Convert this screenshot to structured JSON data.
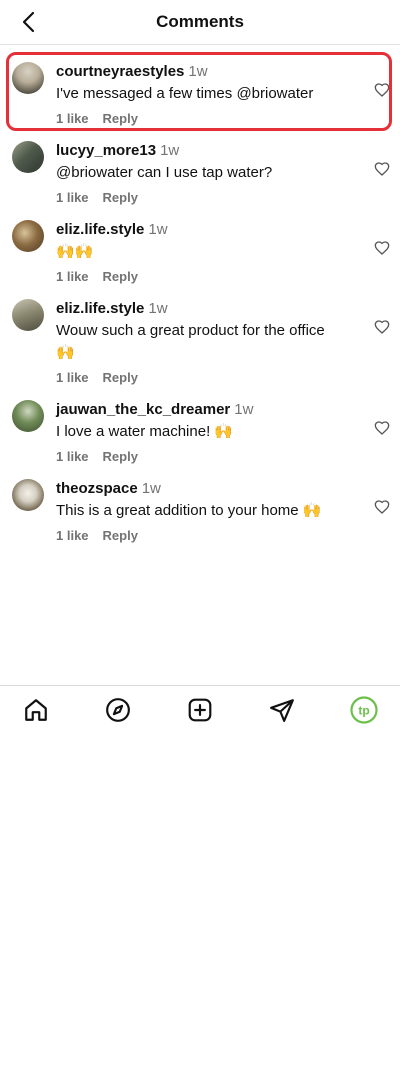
{
  "header": {
    "title": "Comments"
  },
  "comments": [
    {
      "username": "courtneyraestyles",
      "time": "1w",
      "text": "I've messaged a few times @briowater",
      "likes": "1 like",
      "reply": "Reply"
    },
    {
      "username": "lucyy_more13",
      "time": "1w",
      "text": "@briowater can I use tap water?",
      "likes": "1 like",
      "reply": "Reply"
    },
    {
      "username": "eliz.life.style",
      "time": "1w",
      "text": "🙌🙌",
      "likes": "1 like",
      "reply": "Reply"
    },
    {
      "username": "eliz.life.style",
      "time": "1w",
      "text": "Wouw such a great product for the office 🙌",
      "likes": "1 like",
      "reply": "Reply"
    },
    {
      "username": "jauwan_the_kc_dreamer",
      "time": "1w",
      "text": "I love a water machine! 🙌",
      "likes": "1 like",
      "reply": "Reply"
    },
    {
      "username": "theozspace",
      "time": "1w",
      "text": "This is a great addition to your home 🙌",
      "likes": "1 like",
      "reply": "Reply"
    }
  ],
  "tabbar": {
    "profile_initials": "tp"
  },
  "colors": {
    "highlight": "#e5303a",
    "profile_accent": "#6cc04a"
  }
}
